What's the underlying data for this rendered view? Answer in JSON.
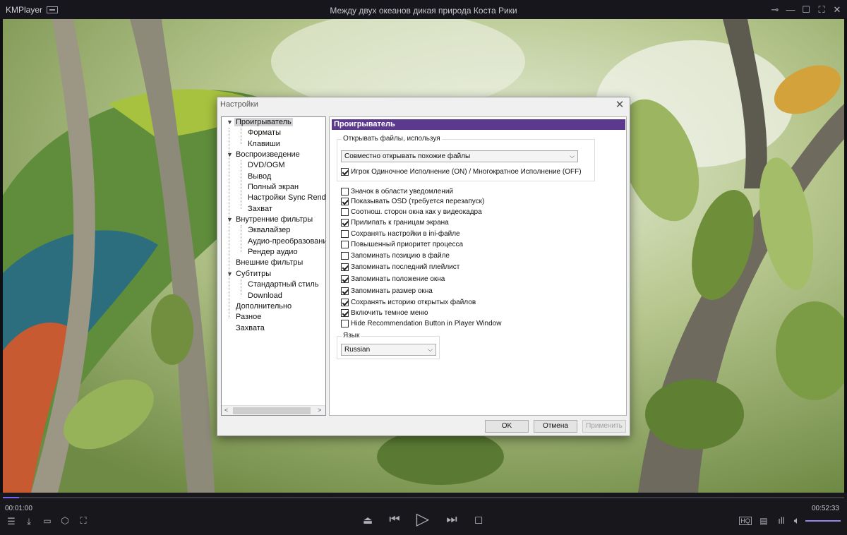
{
  "titlebar": {
    "app_name": "KMPlayer",
    "window_title": "Между двух океанов дикая природа Коста Рики",
    "buttons": [
      "pin-icon",
      "minimize-icon",
      "maximize-icon",
      "fullscreen-icon",
      "close-icon"
    ]
  },
  "dialog": {
    "title": "Настройки",
    "tree": {
      "items": [
        {
          "label": "Проигрыватель",
          "level": 0,
          "expanded": true,
          "selected": true
        },
        {
          "label": "Форматы",
          "level": 1
        },
        {
          "label": "Клавиши",
          "level": 1
        },
        {
          "label": "Воспроизведение",
          "level": 0,
          "expanded": true
        },
        {
          "label": "DVD/OGM",
          "level": 1
        },
        {
          "label": "Вывод",
          "level": 1
        },
        {
          "label": "Полный экран",
          "level": 1
        },
        {
          "label": "Настройки Sync Render",
          "level": 1
        },
        {
          "label": "Захват",
          "level": 1
        },
        {
          "label": "Внутренние фильтры",
          "level": 0,
          "expanded": true
        },
        {
          "label": "Эквалайзер",
          "level": 1
        },
        {
          "label": "Аудио-преобразование",
          "level": 1
        },
        {
          "label": "Рендер аудио",
          "level": 1
        },
        {
          "label": "Внешние фильтры",
          "level": 0
        },
        {
          "label": "Субтитры",
          "level": 0,
          "expanded": true
        },
        {
          "label": "Стандартный стиль",
          "level": 1
        },
        {
          "label": "Download",
          "level": 1
        },
        {
          "label": "Дополнительно",
          "level": 0
        },
        {
          "label": "Разное",
          "level": 0
        },
        {
          "label": "Захвата",
          "level": 0
        }
      ]
    },
    "panel": {
      "header": "Проигрыватель",
      "open_group": {
        "label": "Открывать файлы, используя",
        "select_value": "Совместно открывать похожие файлы",
        "checkbox": {
          "label": "Игрок Одиночное Исполнение (ON) / Многократное Исполнение (OFF)",
          "checked": true
        }
      },
      "options": [
        {
          "label": "Значок в области уведомлений",
          "checked": false
        },
        {
          "label": "Показывать OSD (требуется перезапуск)",
          "checked": true
        },
        {
          "label": "Соотнош. сторон окна как у видеокадра",
          "checked": false
        },
        {
          "label": "Прилипать к границам экрана",
          "checked": true
        },
        {
          "label": "Сохранять настройки в ini-файле",
          "checked": false
        },
        {
          "label": "Повышенный приоритет процесса",
          "checked": false
        },
        {
          "label": "Запоминать позицию в файле",
          "checked": false
        },
        {
          "label": "Запоминать последний плейлист",
          "checked": true
        },
        {
          "label": "Запоминать положение окна",
          "checked": true
        },
        {
          "label": "Запоминать размер окна",
          "checked": true
        },
        {
          "label": "Сохранять историю открытых файлов",
          "checked": true
        },
        {
          "label": "Включить темное меню",
          "checked": true
        },
        {
          "label": "Hide Recommendation Button in Player Window",
          "checked": false
        }
      ],
      "language_group": {
        "label": "Язык",
        "select_value": "Russian"
      }
    },
    "buttons": {
      "ok": "OK",
      "cancel": "Отмена",
      "apply": "Применить"
    }
  },
  "player": {
    "time_elapsed": "00:01:00",
    "time_total": "00:52:33",
    "progress_fraction": 0.019,
    "volume_fraction": 1.0,
    "accent_color": "#7e5ff0"
  }
}
